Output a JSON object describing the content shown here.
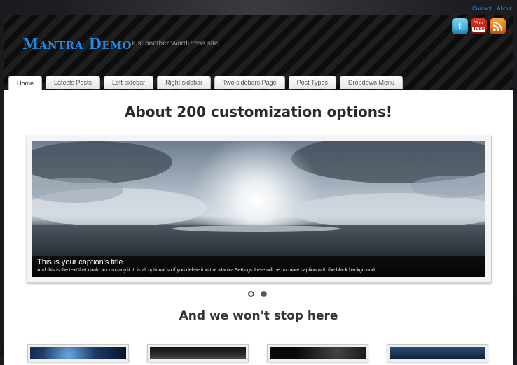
{
  "top_links": [
    "Contact",
    "About"
  ],
  "site": {
    "title": "Mantra Demo",
    "tagline": "Just another WordPress site"
  },
  "social": [
    {
      "name": "twitter-icon",
      "glyph": "t"
    },
    {
      "name": "youtube-icon",
      "line1": "You",
      "line2": "Tube"
    },
    {
      "name": "rss-icon"
    }
  ],
  "nav": [
    {
      "label": "Home",
      "active": true
    },
    {
      "label": "Latests Posts"
    },
    {
      "label": "Left sidebar"
    },
    {
      "label": "Right sidebar"
    },
    {
      "label": "Two sidebars Page"
    },
    {
      "label": "Post Types"
    },
    {
      "label": "Dropdown Menu"
    }
  ],
  "main": {
    "heading": "About 200 customization options!",
    "slider": {
      "caption_title": "This is your caption's title",
      "caption_text": "And this is the text that could accompany it. It is all optional so if you delete it in the Mantra Settings there will be no more caption with the black background.",
      "slides": 2,
      "active_slide": 1
    },
    "subheading": "And we won't stop here"
  },
  "colors": {
    "title_blue": "#1e88e5",
    "link_blue": "#3a8fd8",
    "header_dark": "#141414"
  }
}
